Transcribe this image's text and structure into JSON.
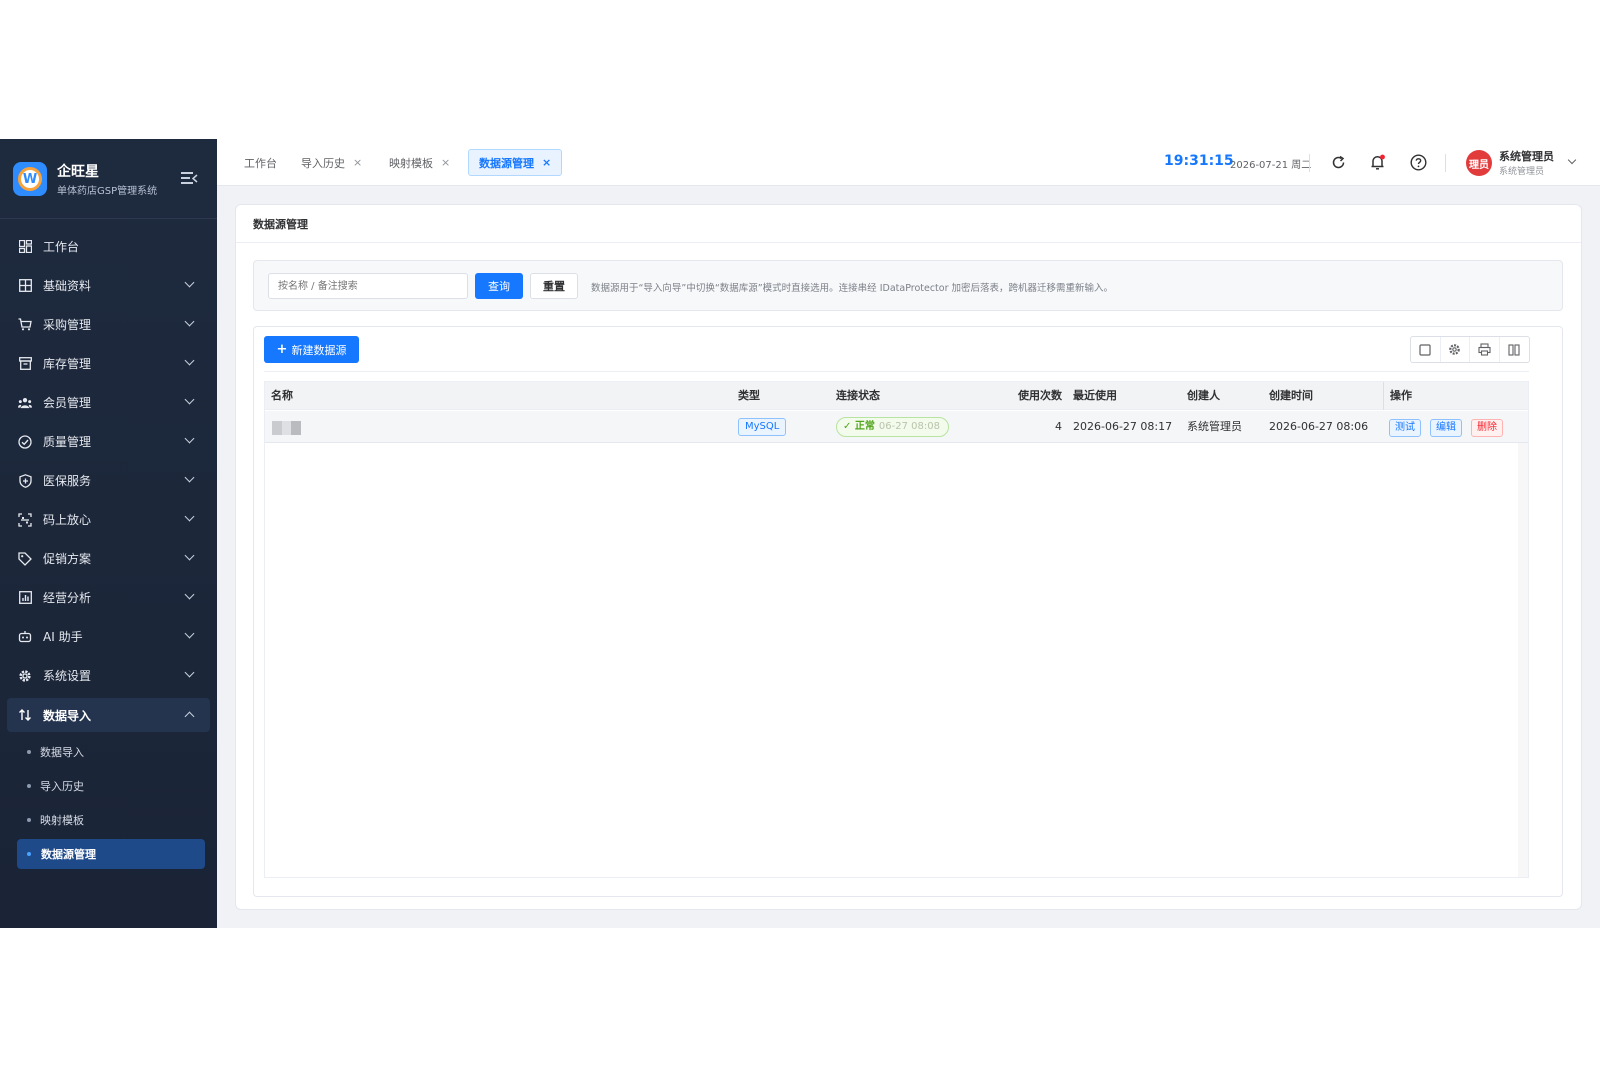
{
  "brand": {
    "title": "企旺星",
    "subtitle": "单体药店GSP管理系统",
    "logo_letter": "W"
  },
  "sidebar": {
    "items": [
      {
        "label": "工作台",
        "icon": "dashboard-icon",
        "has_children": false
      },
      {
        "label": "基础资料",
        "icon": "grid-icon",
        "has_children": true
      },
      {
        "label": "采购管理",
        "icon": "cart-icon",
        "has_children": true
      },
      {
        "label": "库存管理",
        "icon": "box-icon",
        "has_children": true
      },
      {
        "label": "会员管理",
        "icon": "users-icon",
        "has_children": true
      },
      {
        "label": "质量管理",
        "icon": "check-circle-icon",
        "has_children": true
      },
      {
        "label": "医保服务",
        "icon": "shield-icon",
        "has_children": true
      },
      {
        "label": "码上放心",
        "icon": "scan-icon",
        "has_children": true
      },
      {
        "label": "促销方案",
        "icon": "tag-icon",
        "has_children": true
      },
      {
        "label": "经营分析",
        "icon": "bar-chart-icon",
        "has_children": true
      },
      {
        "label": "AI 助手",
        "icon": "robot-icon",
        "has_children": true
      },
      {
        "label": "系统设置",
        "icon": "gear-icon",
        "has_children": true
      }
    ],
    "open_group": {
      "label": "数据导入",
      "icon": "import-icon"
    },
    "sub_items": [
      "数据导入",
      "导入历史",
      "映射模板",
      "数据源管理"
    ],
    "active_sub": "数据源管理"
  },
  "header": {
    "tabs": [
      {
        "label": "工作台",
        "closable": false
      },
      {
        "label": "导入历史",
        "closable": true
      },
      {
        "label": "映射模板",
        "closable": true
      },
      {
        "label": "数据源管理",
        "closable": true,
        "active": true
      }
    ],
    "close_glyph": "×",
    "clock": "19:31:15",
    "date": "2026-07-21 周二",
    "user": {
      "avatar_text": "理员",
      "name": "系统管理员",
      "role": "系统管理员"
    }
  },
  "page": {
    "title": "数据源管理",
    "search": {
      "placeholder": "按名称 / 备注搜索",
      "query_label": "查询",
      "reset_label": "重置",
      "tip": "数据源用于“导入向导”中切换“数据库源”模式时直接选用。连接串经 IDataProtector 加密后落表，跨机器迁移需重新输入。"
    },
    "new_button": "新建数据源",
    "toolbar_icons": [
      "fullscreen-icon",
      "settings-icon",
      "print-icon",
      "columns-icon"
    ]
  },
  "table": {
    "columns": [
      "名称",
      "类型",
      "连接状态",
      "使用次数",
      "最近使用",
      "创建人",
      "创建时间",
      "操作"
    ],
    "rows": [
      {
        "name": "",
        "type": "MySQL",
        "status": "✓ 正常",
        "status_time": "06-27 08:08",
        "use_count": "4",
        "last_used": "2026-06-27 08:17",
        "creator": "系统管理员",
        "created_at": "2026-06-27 08:06",
        "actions": {
          "test": "测试",
          "edit": "编辑",
          "delete": "删除"
        }
      }
    ]
  },
  "colors": {
    "primary": "#1677ff",
    "sidebar_bg": "#1e2a3e",
    "success": "#52a51f",
    "danger": "#f5222d",
    "avatar": "#e23b3b"
  }
}
